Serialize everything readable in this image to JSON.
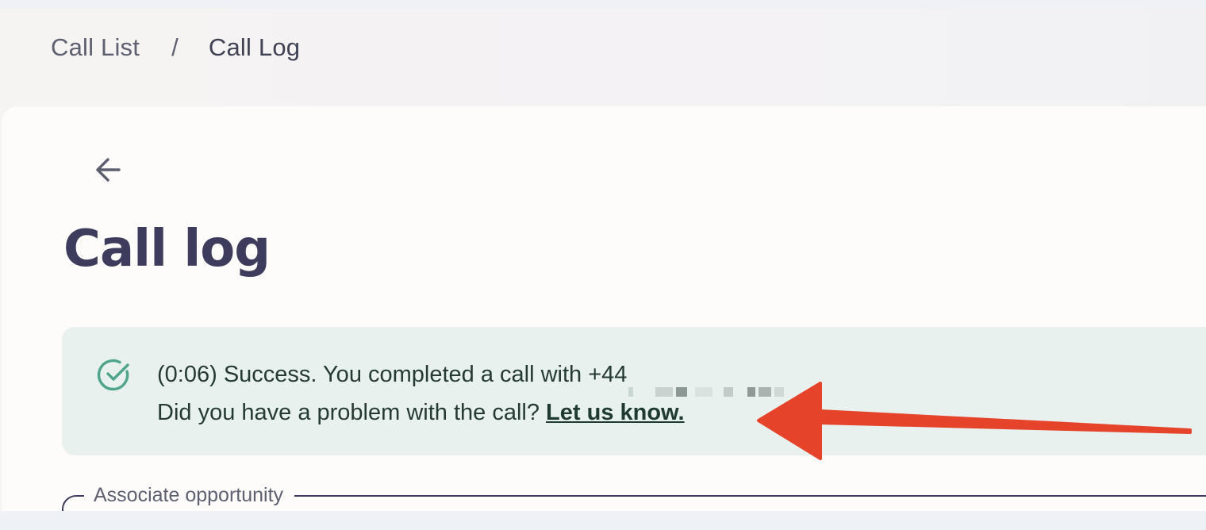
{
  "breadcrumb": {
    "parent": "Call List",
    "separator": "/",
    "current": "Call Log"
  },
  "page": {
    "title": "Call log"
  },
  "alert": {
    "line1": "(0:06) Success. You completed a call with +44",
    "line2": "Did you have a problem with the call?",
    "link": "Let us know.",
    "icon": "check-circle-icon",
    "status": "success",
    "color": "#e8f1ee"
  },
  "form": {
    "associate_label": "Associate opportunity"
  },
  "colors": {
    "title": "#3d3c5c",
    "arrow": "#e5432a",
    "success_icon": "#4fa58b"
  }
}
